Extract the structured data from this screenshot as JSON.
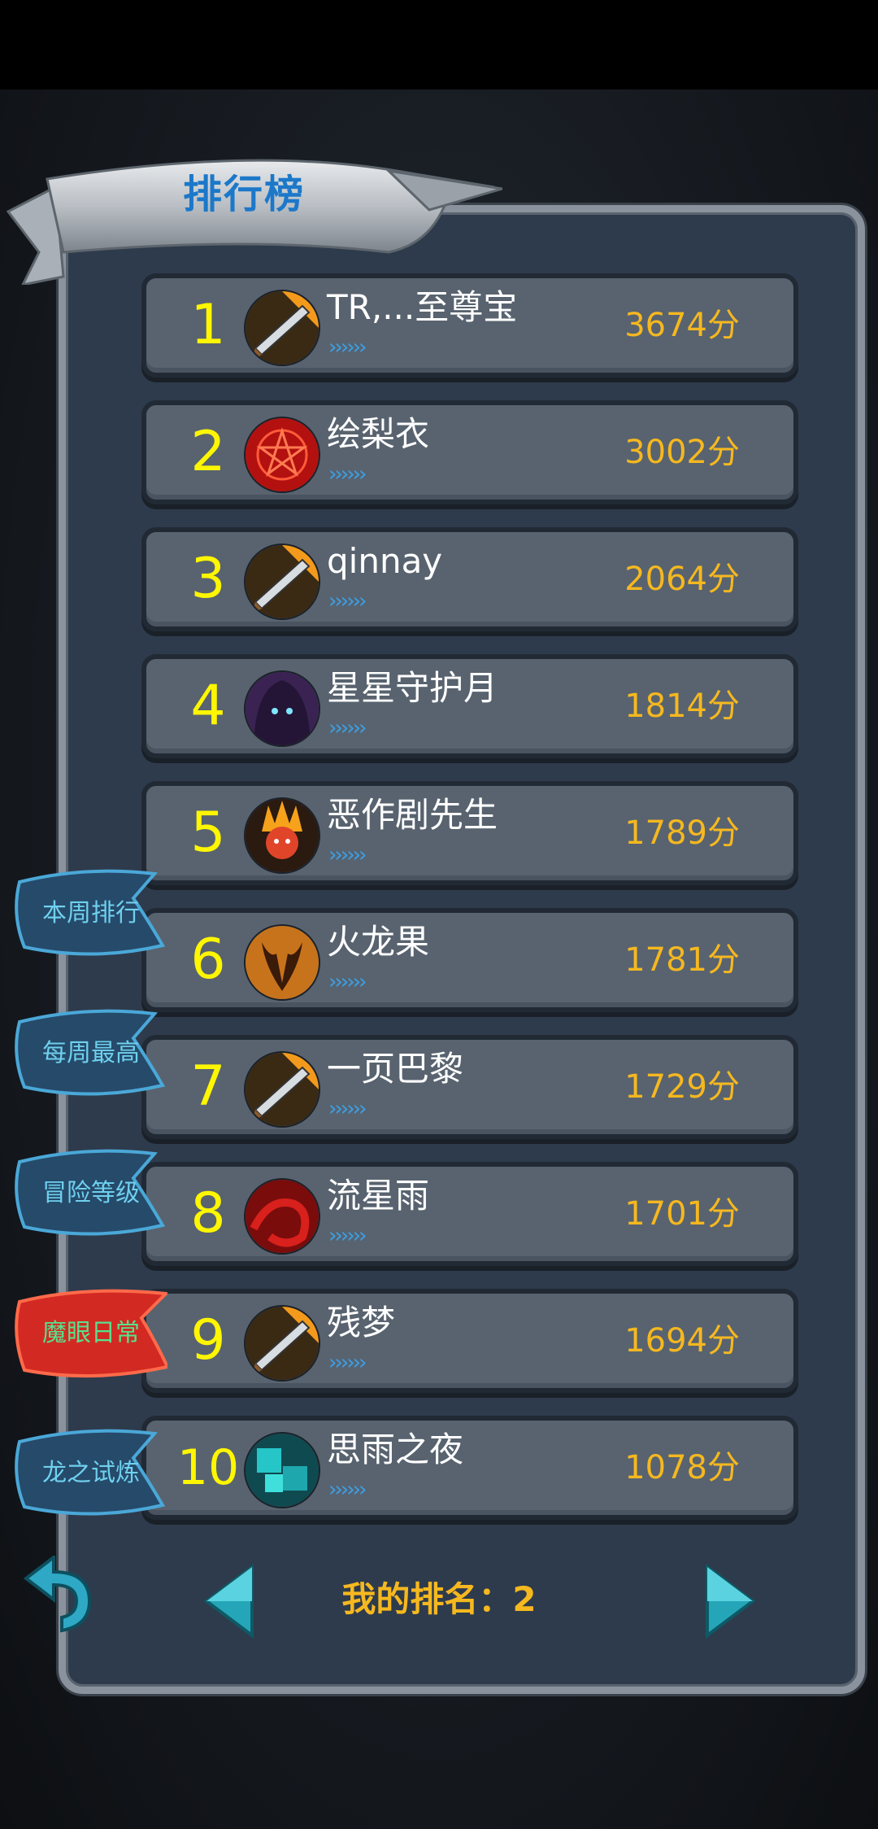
{
  "leaderboard": {
    "title": "排行榜",
    "entries": [
      {
        "rank": "1",
        "name": "TR,...至尊宝",
        "score": "3674分",
        "avatar": "flaming-sword-icon",
        "progress": "››››››"
      },
      {
        "rank": "2",
        "name": "绘梨衣",
        "score": "3002分",
        "avatar": "red-pentagram-icon",
        "progress": "››››››"
      },
      {
        "rank": "3",
        "name": "qinnay",
        "score": "2064分",
        "avatar": "flaming-sword-icon",
        "progress": "››››››"
      },
      {
        "rank": "4",
        "name": "星星守护月",
        "score": "1814分",
        "avatar": "hooded-figure-icon",
        "progress": "››››››"
      },
      {
        "rank": "5",
        "name": "恶作剧先生",
        "score": "1789分",
        "avatar": "fire-demon-icon",
        "progress": "››››››"
      },
      {
        "rank": "6",
        "name": "火龙果",
        "score": "1781分",
        "avatar": "horned-demon-icon",
        "progress": "››››››"
      },
      {
        "rank": "7",
        "name": "一页巴黎",
        "score": "1729分",
        "avatar": "flaming-sword-icon",
        "progress": "››››››"
      },
      {
        "rank": "8",
        "name": "流星雨",
        "score": "1701分",
        "avatar": "red-swirl-icon",
        "progress": "››››››"
      },
      {
        "rank": "9",
        "name": "残梦",
        "score": "1694分",
        "avatar": "flaming-sword-icon",
        "progress": "››››››"
      },
      {
        "rank": "10",
        "name": "思雨之夜",
        "score": "1078分",
        "avatar": "teal-cubes-icon",
        "progress": "››››››"
      }
    ],
    "my_rank_label": "我的排名：2"
  },
  "side_tabs": [
    {
      "label": "本周排行",
      "active": false
    },
    {
      "label": "每周最高",
      "active": false
    },
    {
      "label": "冒险等级",
      "active": false
    },
    {
      "label": "魔眼日常",
      "active": true
    },
    {
      "label": "龙之试炼",
      "active": false
    }
  ],
  "colors": {
    "rank": "#fff600",
    "score": "#f6b81f",
    "tab_text": "#6fd0ee",
    "active_tab_text": "#56e28e",
    "title": "#1c78c9"
  }
}
